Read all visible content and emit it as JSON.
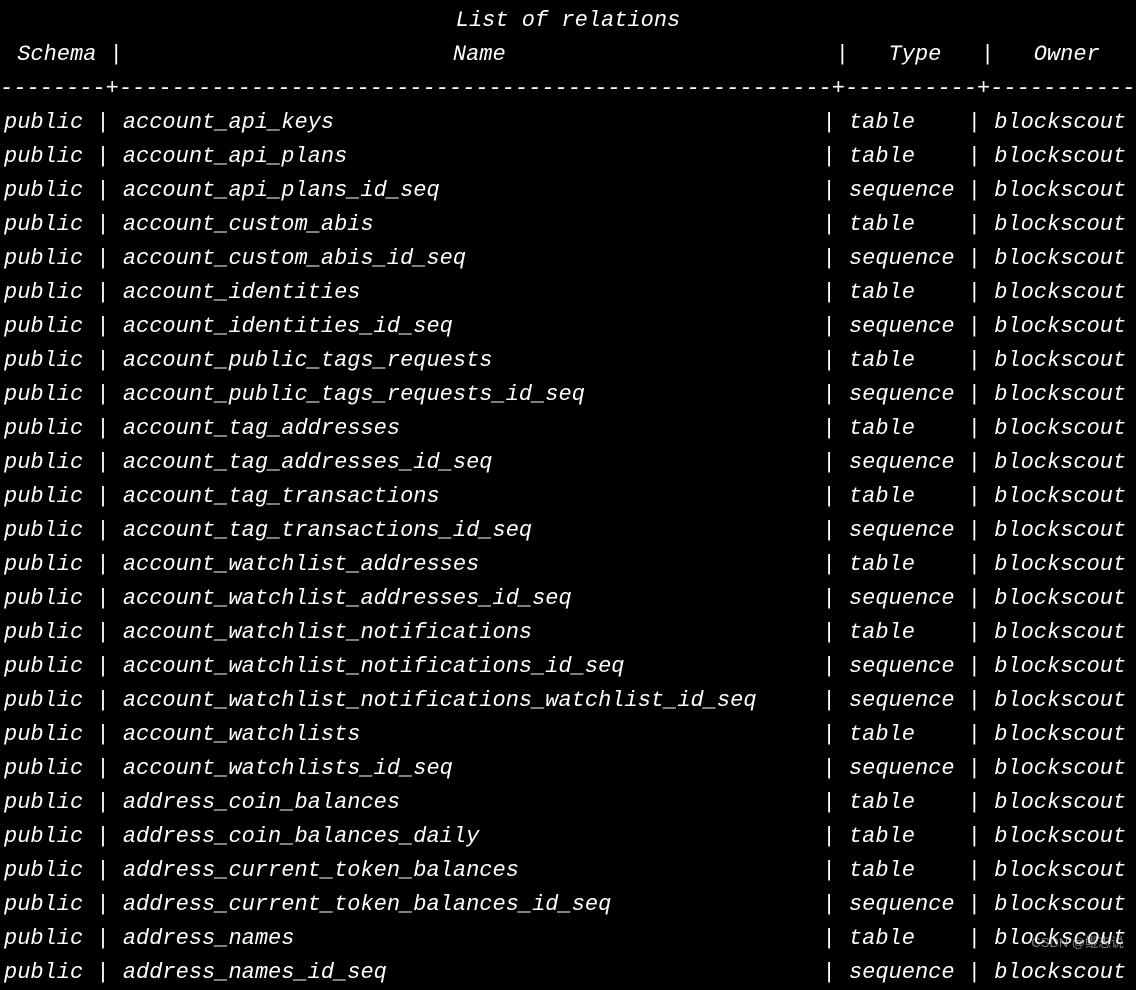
{
  "title": "List of relations",
  "columns": {
    "schema": "Schema",
    "name": "Name",
    "type": "Type",
    "owner": "Owner"
  },
  "widths": {
    "schema": 8,
    "name": 54,
    "type": 10,
    "owner": 12
  },
  "rows": [
    {
      "schema": "public",
      "name": "account_api_keys",
      "type": "table",
      "owner": "blockscout"
    },
    {
      "schema": "public",
      "name": "account_api_plans",
      "type": "table",
      "owner": "blockscout"
    },
    {
      "schema": "public",
      "name": "account_api_plans_id_seq",
      "type": "sequence",
      "owner": "blockscout"
    },
    {
      "schema": "public",
      "name": "account_custom_abis",
      "type": "table",
      "owner": "blockscout"
    },
    {
      "schema": "public",
      "name": "account_custom_abis_id_seq",
      "type": "sequence",
      "owner": "blockscout"
    },
    {
      "schema": "public",
      "name": "account_identities",
      "type": "table",
      "owner": "blockscout"
    },
    {
      "schema": "public",
      "name": "account_identities_id_seq",
      "type": "sequence",
      "owner": "blockscout"
    },
    {
      "schema": "public",
      "name": "account_public_tags_requests",
      "type": "table",
      "owner": "blockscout"
    },
    {
      "schema": "public",
      "name": "account_public_tags_requests_id_seq",
      "type": "sequence",
      "owner": "blockscout"
    },
    {
      "schema": "public",
      "name": "account_tag_addresses",
      "type": "table",
      "owner": "blockscout"
    },
    {
      "schema": "public",
      "name": "account_tag_addresses_id_seq",
      "type": "sequence",
      "owner": "blockscout"
    },
    {
      "schema": "public",
      "name": "account_tag_transactions",
      "type": "table",
      "owner": "blockscout"
    },
    {
      "schema": "public",
      "name": "account_tag_transactions_id_seq",
      "type": "sequence",
      "owner": "blockscout"
    },
    {
      "schema": "public",
      "name": "account_watchlist_addresses",
      "type": "table",
      "owner": "blockscout"
    },
    {
      "schema": "public",
      "name": "account_watchlist_addresses_id_seq",
      "type": "sequence",
      "owner": "blockscout"
    },
    {
      "schema": "public",
      "name": "account_watchlist_notifications",
      "type": "table",
      "owner": "blockscout"
    },
    {
      "schema": "public",
      "name": "account_watchlist_notifications_id_seq",
      "type": "sequence",
      "owner": "blockscout"
    },
    {
      "schema": "public",
      "name": "account_watchlist_notifications_watchlist_id_seq",
      "type": "sequence",
      "owner": "blockscout"
    },
    {
      "schema": "public",
      "name": "account_watchlists",
      "type": "table",
      "owner": "blockscout"
    },
    {
      "schema": "public",
      "name": "account_watchlists_id_seq",
      "type": "sequence",
      "owner": "blockscout"
    },
    {
      "schema": "public",
      "name": "address_coin_balances",
      "type": "table",
      "owner": "blockscout"
    },
    {
      "schema": "public",
      "name": "address_coin_balances_daily",
      "type": "table",
      "owner": "blockscout"
    },
    {
      "schema": "public",
      "name": "address_current_token_balances",
      "type": "table",
      "owner": "blockscout"
    },
    {
      "schema": "public",
      "name": "address_current_token_balances_id_seq",
      "type": "sequence",
      "owner": "blockscout"
    },
    {
      "schema": "public",
      "name": "address_names",
      "type": "table",
      "owner": "blockscout"
    },
    {
      "schema": "public",
      "name": "address_names_id_seq",
      "type": "sequence",
      "owner": "blockscout"
    }
  ],
  "watermark": "CSDN @鲲志说"
}
